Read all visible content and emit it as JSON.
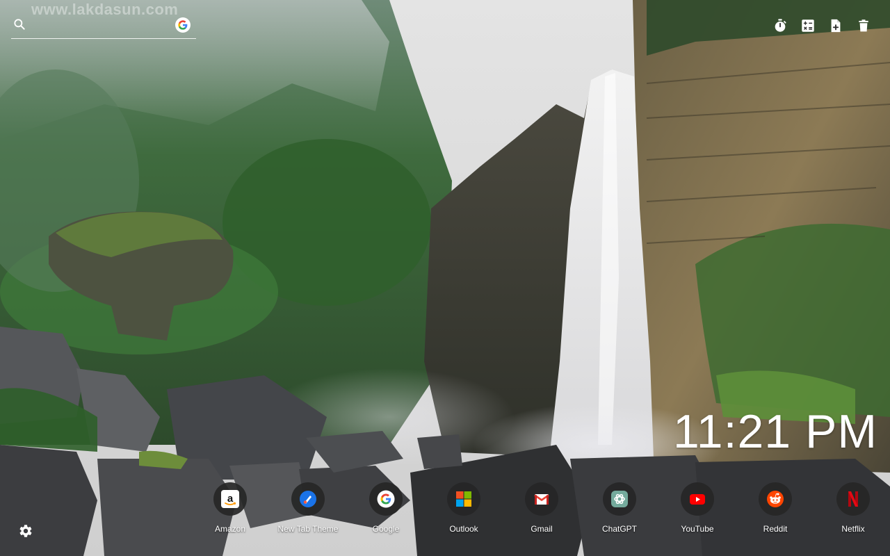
{
  "watermark": "www.lakdasun.com",
  "search": {
    "placeholder": "",
    "value": "",
    "engine_icon": "google-icon"
  },
  "toolbar": {
    "icons": [
      "timer-icon",
      "calculator-icon",
      "add-note-icon",
      "trash-icon"
    ]
  },
  "clock": {
    "time": "11:21 PM"
  },
  "shortcuts": [
    {
      "label": "Amazon",
      "icon": "amazon-icon"
    },
    {
      "label": "New Tab Theme",
      "icon": "new-tab-theme-icon"
    },
    {
      "label": "Google",
      "icon": "google-icon"
    },
    {
      "label": "Outlook",
      "icon": "windows-icon"
    },
    {
      "label": "Gmail",
      "icon": "gmail-icon"
    },
    {
      "label": "ChatGPT",
      "icon": "chatgpt-icon"
    },
    {
      "label": "YouTube",
      "icon": "youtube-icon"
    },
    {
      "label": "Reddit",
      "icon": "reddit-icon"
    },
    {
      "label": "Netflix",
      "icon": "netflix-icon"
    }
  ],
  "settings": {
    "icon": "gear-icon"
  },
  "colors": {
    "sky": "#dcdcdc",
    "foliage": "#3f6b3c",
    "rock": "#3a3835",
    "tile_bg": "#262626",
    "google_blue": "#4285F4",
    "google_red": "#EA4335",
    "google_yellow": "#FBBC05",
    "google_green": "#34A853",
    "youtube_red": "#FF0000",
    "reddit_orange": "#FF4500",
    "netflix_red": "#E50914"
  }
}
